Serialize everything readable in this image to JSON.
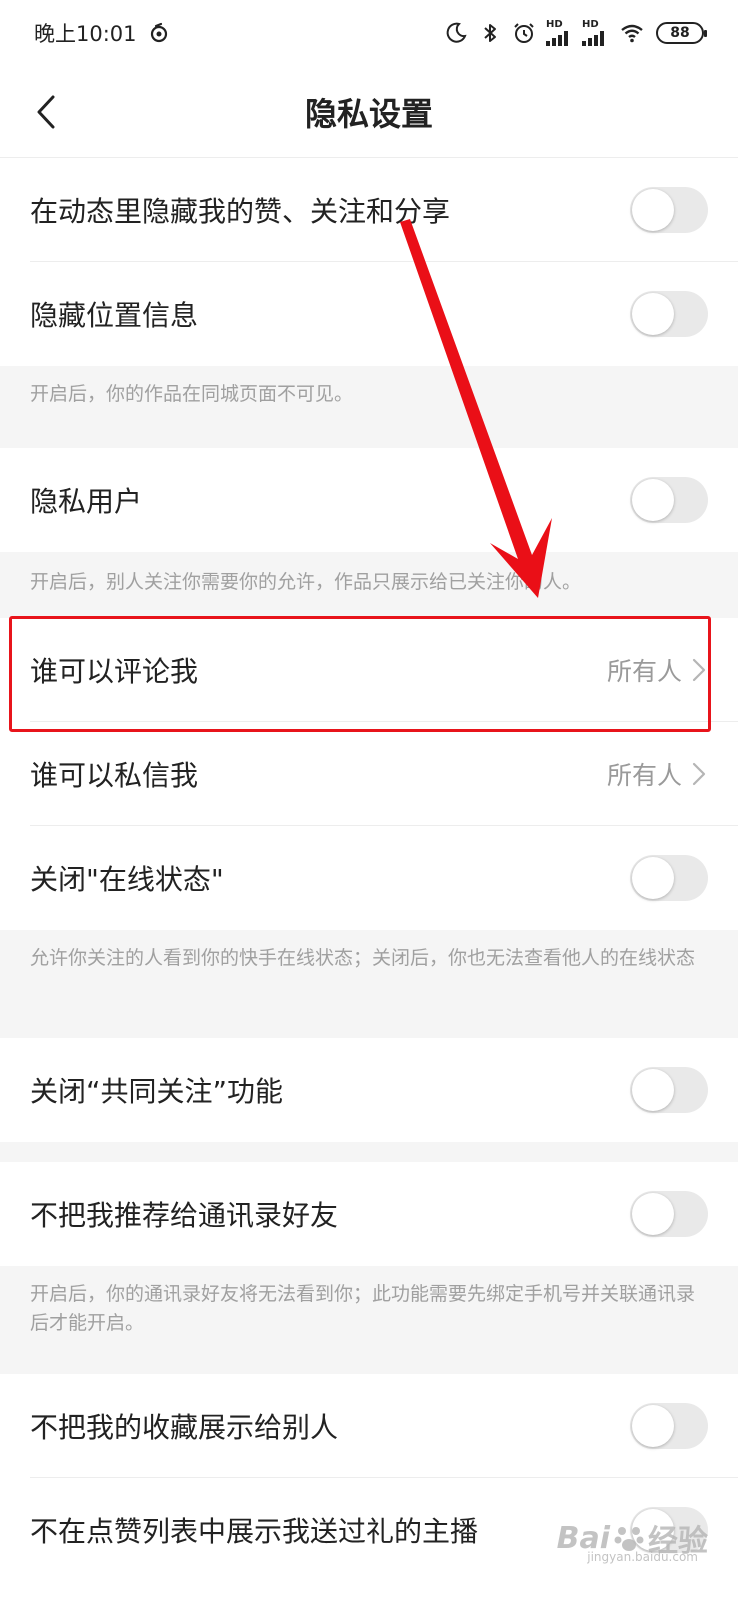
{
  "status_bar": {
    "time": "晚上10:01",
    "battery": "88",
    "hd1": "HD",
    "hd2": "HD"
  },
  "header": {
    "title": "隐私设置"
  },
  "items": [
    {
      "label": "在动态里隐藏我的赞、关注和分享",
      "type": "toggle",
      "on": false
    },
    {
      "label": "隐藏位置信息",
      "type": "toggle",
      "on": false,
      "note": "开启后，你的作品在同城页面不可见。"
    },
    {
      "label": "隐私用户",
      "type": "toggle",
      "on": false,
      "note": "开启后，别人关注你需要你的允许，作品只展示给已关注你的人。"
    },
    {
      "label": "谁可以评论我",
      "type": "link",
      "value": "所有人"
    },
    {
      "label": "谁可以私信我",
      "type": "link",
      "value": "所有人"
    },
    {
      "label": "关闭\"在线状态\"",
      "type": "toggle",
      "on": false,
      "note": "允许你关注的人看到你的快手在线状态；关闭后，你也无法查看他人的在线状态"
    },
    {
      "label": "关闭“共同关注”功能",
      "type": "toggle",
      "on": false
    },
    {
      "label": "不把我推荐给通讯录好友",
      "type": "toggle",
      "on": false,
      "note": "开启后，你的通讯录好友将无法看到你；此功能需要先绑定手机号并关联通讯录后才能开启。"
    },
    {
      "label": "不把我的收藏展示给别人",
      "type": "toggle",
      "on": false
    },
    {
      "label": "不在点赞列表中展示我送过礼的主播",
      "type": "toggle",
      "on": false
    }
  ],
  "colors": {
    "highlight": "#e8141b",
    "toggle_off": "#e9e9e9",
    "note_bg": "#f5f5f5"
  },
  "watermark": {
    "brand": "Bai",
    "brand2": "经验",
    "sub": "jingyan.baidu.com"
  }
}
